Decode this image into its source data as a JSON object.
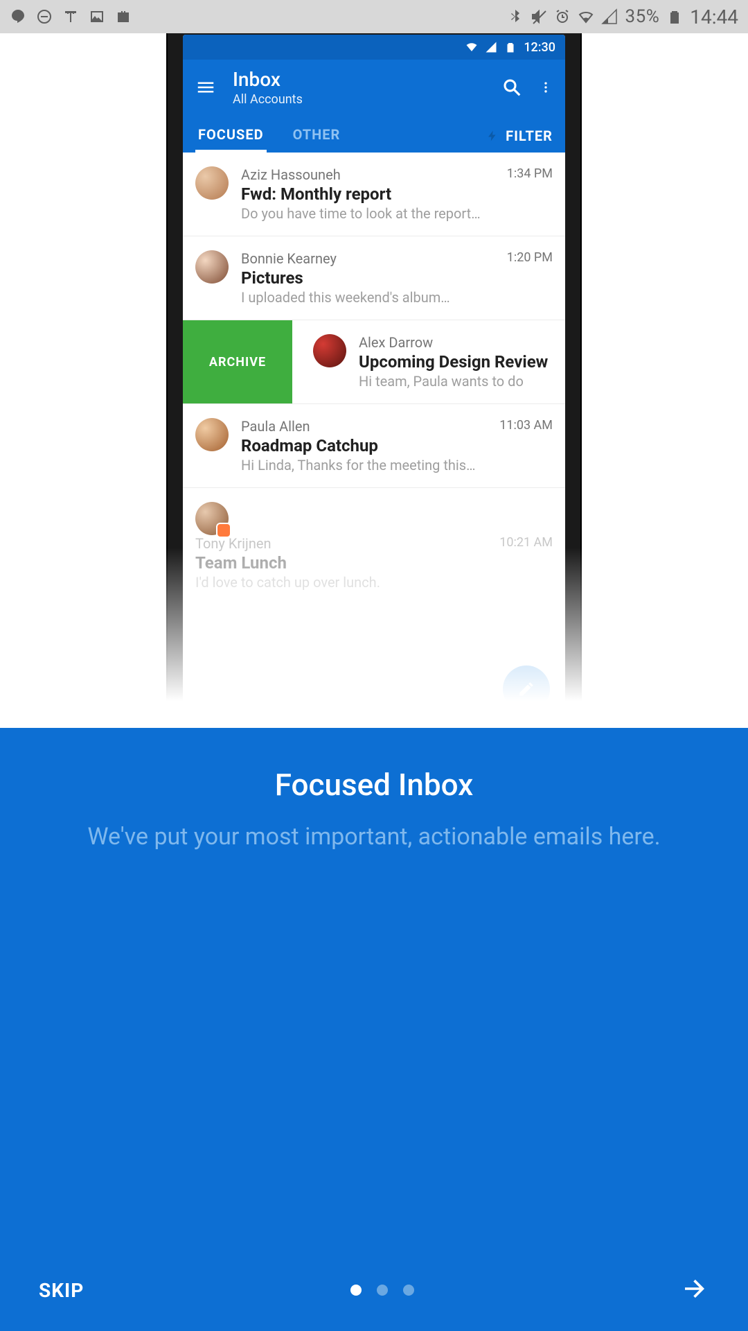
{
  "sysbar": {
    "battery_pct": "35%",
    "clock": "14:44"
  },
  "phone": {
    "status_time": "12:30",
    "toolbar": {
      "title": "Inbox",
      "subtitle": "All Accounts",
      "tab_focused": "FOCUSED",
      "tab_other": "OTHER",
      "filter": "FILTER"
    },
    "archive_label": "ARCHIVE",
    "messages": [
      {
        "sender": "Aziz Hassouneh",
        "subject": "Fwd: Monthly report",
        "preview": "Do you have time to look at the report…",
        "time": "1:34 PM"
      },
      {
        "sender": "Bonnie Kearney",
        "subject": "Pictures",
        "preview": "I uploaded this weekend's album…",
        "time": "1:20 PM"
      },
      {
        "sender": "Alex Darrow",
        "subject": "Upcoming Design Review",
        "preview": "Hi team, Paula wants to do",
        "time": ""
      },
      {
        "sender": "Paula Allen",
        "subject": "Roadmap Catchup",
        "preview": "Hi Linda, Thanks for the meeting this…",
        "time": "11:03 AM"
      },
      {
        "sender": "Tony Krijnen",
        "subject": "Team Lunch",
        "preview": "I'd love to catch up over lunch.",
        "time": "10:21 AM"
      }
    ]
  },
  "banner": {
    "title": "Focused Inbox",
    "body": "We've put your most important, actionable emails here.",
    "skip": "SKIP"
  }
}
